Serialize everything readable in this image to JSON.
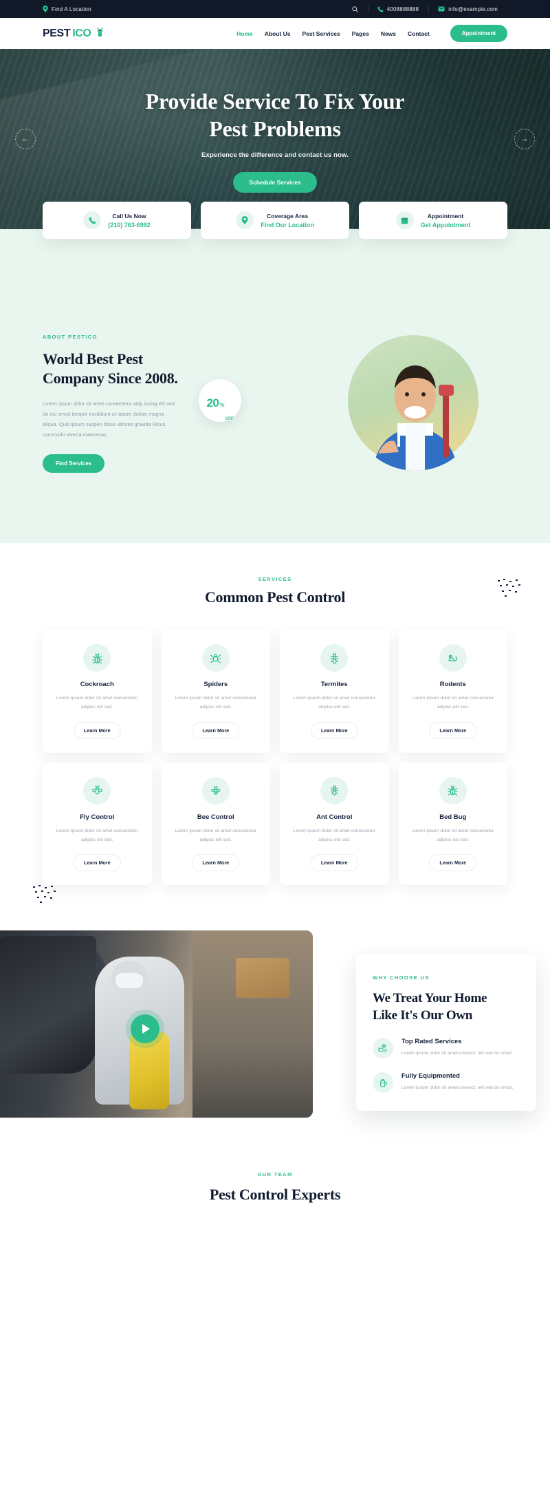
{
  "topbar": {
    "location_label": "Find A Location",
    "phone": "4008888888",
    "email": "info@example.com",
    "search_icon": "search-icon",
    "location_icon": "map-pin-icon",
    "phone_icon": "phone-icon",
    "email_icon": "envelope-icon"
  },
  "nav": {
    "logo_part1": "PEST",
    "logo_part2": "ICO",
    "items": [
      {
        "label": "Home",
        "active": true
      },
      {
        "label": "About Us",
        "active": false
      },
      {
        "label": "Pest Services",
        "active": false
      },
      {
        "label": "Pages",
        "active": false
      },
      {
        "label": "News",
        "active": false
      },
      {
        "label": "Contact",
        "active": false
      }
    ],
    "appointment_label": "Appointment"
  },
  "hero": {
    "title_line1": "Provide Service To Fix Your",
    "title_line2": "Pest Problems",
    "subtitle": "Experience the difference and contact us now.",
    "cta_label": "Schedule Services",
    "prev_arrow": "←",
    "next_arrow": "→"
  },
  "info_cards": [
    {
      "icon": "phone-icon",
      "title": "Call Us Now",
      "value": "(210) 763-6992"
    },
    {
      "icon": "map-pin-icon",
      "title": "Coverage Area",
      "value": "Find Our Location"
    },
    {
      "icon": "calendar-icon",
      "title": "Appointment",
      "value": "Get Appointment"
    }
  ],
  "about": {
    "eyebrow": "ABOUT PESTICO",
    "heading": "World Best Pest Company Since 2008.",
    "body": "Lorem ipsum dolor sit amet consectetur adip iscing elit sed do eiu smod tempor incididunt ut labore dolore magna aliqua. Quis ipsum suspen disse ultrices gravida Risus commodo viverra maecenas.",
    "cta_label": "Find Services",
    "discount_number": "20",
    "discount_percent": "%",
    "discount_off": "OFF"
  },
  "services": {
    "eyebrow": "SERVICES",
    "heading": "Common Pest Control",
    "learn_more_label": "Learn More",
    "items": [
      {
        "icon": "beetle-icon",
        "title": "Cockroach",
        "desc": "Lorem ipsum dolor sit amet consectetur adipisc elit sed."
      },
      {
        "icon": "spider-icon",
        "title": "Spiders",
        "desc": "Lorem ipsum dolor sit amet consectetur adipisc elit sed."
      },
      {
        "icon": "termite-icon",
        "title": "Termites",
        "desc": "Lorem ipsum dolor sit amet consectetur adipisc elit sed."
      },
      {
        "icon": "rodent-icon",
        "title": "Rodents",
        "desc": "Lorem ipsum dolor sit amet consectetur adipisc elit sed."
      },
      {
        "icon": "fly-icon",
        "title": "Fly Control",
        "desc": "Lorem ipsum dolor sit amet consectetur adipisc elit sed."
      },
      {
        "icon": "bee-icon",
        "title": "Bee Control",
        "desc": "Lorem ipsum dolor sit amet consectetur adipisc elit sed."
      },
      {
        "icon": "ant-icon",
        "title": "Ant Control",
        "desc": "Lorem ipsum dolor sit amet consectetur adipisc elit sed."
      },
      {
        "icon": "bedbug-icon",
        "title": "Bed Bug",
        "desc": "Lorem ipsum dolor sit amet consectetur adipisc elit sed."
      }
    ]
  },
  "why_choose": {
    "eyebrow": "WHY CHOOSE US",
    "heading_line1": "We Treat Your Home",
    "heading_line2": "Like It's Our Own",
    "play_icon": "play-icon",
    "features": [
      {
        "icon": "award-icon",
        "title": "Top Rated Services",
        "desc": "Lorem ipsum dolor sit amet consect. elit sed do smod."
      },
      {
        "icon": "equipment-icon",
        "title": "Fully Equipmented",
        "desc": "Lorem ipsum dolor sit amet consect. elit sed do smod."
      }
    ]
  },
  "team": {
    "eyebrow": "OUR TEAM",
    "heading": "Pest Control Experts"
  },
  "colors": {
    "accent": "#2bbd8c",
    "dark": "#111827",
    "mint_bg": "#e9f6f0",
    "muted": "#9aa5b0"
  }
}
